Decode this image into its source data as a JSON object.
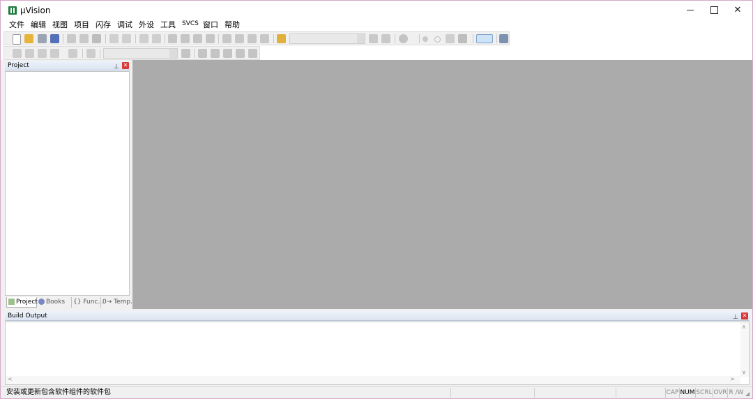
{
  "window": {
    "title": "µVision"
  },
  "menu": [
    "文件",
    "编辑",
    "视图",
    "项目",
    "闪存",
    "调试",
    "外设",
    "工具",
    "SVCS",
    "窗口",
    "帮助"
  ],
  "panels": {
    "project": {
      "title": "Project"
    },
    "build_output": {
      "title": "Build Output"
    }
  },
  "project_tabs": [
    "Project",
    "Books",
    "{} Func...",
    "0→ Temp..."
  ],
  "status": {
    "message": "安装或更新包含软件组件的软件包",
    "indicators": [
      "CAP",
      "NUM",
      "SCRL",
      "OVR",
      "R /W"
    ],
    "active_indicator": "NUM"
  }
}
